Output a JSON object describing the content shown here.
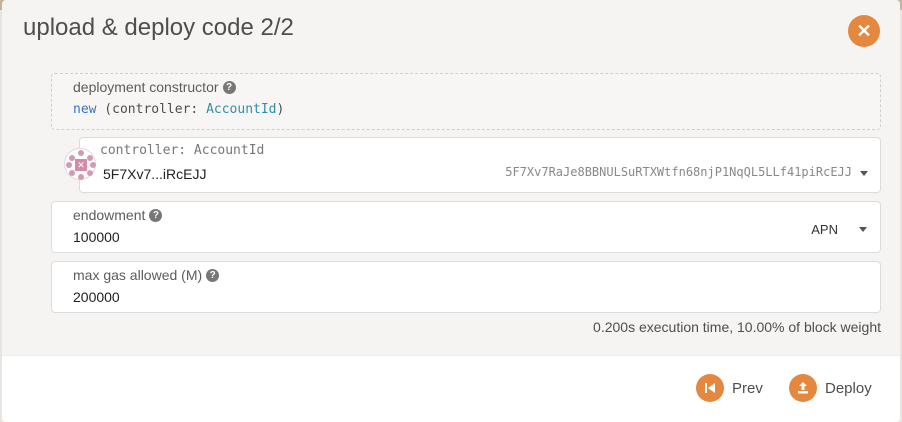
{
  "modal": {
    "title": "upload & deploy code 2/2",
    "close_icon": "close-icon"
  },
  "constructor": {
    "label": "deployment constructor",
    "help_icon": "help-icon",
    "keyword": "new",
    "open_paren": " (controller: ",
    "type": "AccountId",
    "close_paren": ")"
  },
  "account": {
    "label": "controller: AccountId",
    "short_address": "5F7Xv7...iRcEJJ",
    "full_address": "5F7Xv7RaJe8BBNULSuRTXWtfn68njP1NqQL5LLf41piRcEJJ",
    "avatar_icon": "identicon-icon"
  },
  "endowment": {
    "label": "endowment",
    "value": "100000",
    "unit": "APN"
  },
  "gas": {
    "label": "max gas allowed (M)",
    "value": "200000"
  },
  "execution_info": "0.200s execution time, 10.00% of block weight",
  "footer": {
    "prev_label": "Prev",
    "deploy_label": "Deploy"
  },
  "colors": {
    "accent": "#e5883f",
    "keyword": "#3772c8",
    "type": "#2e8fa6"
  }
}
